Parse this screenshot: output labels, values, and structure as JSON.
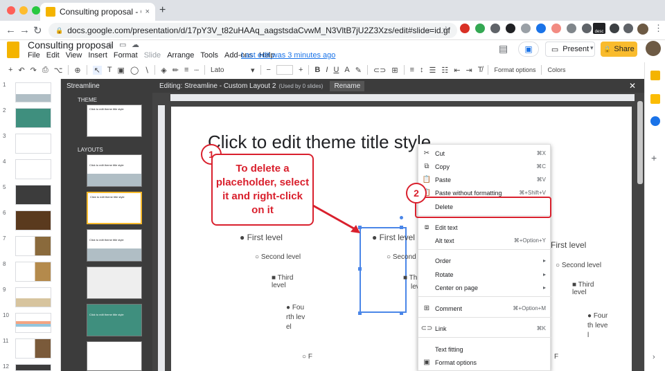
{
  "browser": {
    "tab_title": "Consulting proposal - Google S",
    "tab_close": "×",
    "new_tab": "+",
    "url": "docs.google.com/presentation/d/17pY3V_t82uHAAq_aagstsdaCvwM_N3VltB7jU2Z3Xzs/edit#slide=id.gf0f1c8062...",
    "lock_icon": "🔒",
    "back": "←",
    "forward": "→",
    "reload": "↻",
    "search_icon": "⌕",
    "star_icon": "☆",
    "ext_label_desc": "desc"
  },
  "header": {
    "doc_title": "Consulting proposal",
    "menus": [
      "File",
      "Edit",
      "View",
      "Insert",
      "Format",
      "Slide",
      "Arrange",
      "Tools",
      "Add-ons",
      "Help"
    ],
    "last_edit": "Last edit was 3 minutes ago",
    "present": "Present",
    "share": "Share",
    "comment_icon": "▤",
    "meet_icon": "▣"
  },
  "toolbar": {
    "font": "Lato",
    "format_options": "Format options",
    "colors": "Colors",
    "undo": "↶",
    "redo": "↷",
    "print": "⎙",
    "paint": "⌥",
    "zoom": "⊕",
    "cursor": "↖",
    "textbox": "T",
    "image": "▣",
    "shape": "◯",
    "line": "∖",
    "bold": "B",
    "italic": "I",
    "underline": "U",
    "textcolor": "A",
    "highlight": "✎",
    "link": "⊂⊃",
    "comment": "⊞",
    "align": "≡",
    "spacing": "↕",
    "list1": "☰",
    "list2": "☷",
    "indent": "⇤",
    "indent2": "⇥",
    "clear": "T̸",
    "minus": "−",
    "plus": "+"
  },
  "filmstrip": {
    "numbers": [
      "1",
      "2",
      "3",
      "4",
      "5",
      "6",
      "7",
      "8",
      "9",
      "10",
      "11",
      "12"
    ]
  },
  "master": {
    "title": "Streamline",
    "theme_label": "THEME",
    "layouts_label": "LAYOUTS",
    "theme_thumb_text": "Click to edit theme title style",
    "layout_thumb_text": "Click to edit theme title style"
  },
  "editor": {
    "title": "Editing: Streamline - Custom Layout 2",
    "subtitle": "(Used by 0 slides)",
    "rename": "Rename",
    "close": "✕"
  },
  "slide": {
    "title": "Click to edit theme title style",
    "col1": {
      "first": "First level",
      "second": "Second level",
      "third": "Third level",
      "fourth": "Fourth level",
      "fifth": "F"
    },
    "col2": {
      "first": "First level",
      "second": "Second",
      "third": "Th",
      "third2": "lev"
    },
    "col3": {
      "first": "First level",
      "second": "Second level",
      "third": "Third level",
      "fourth": "Fourth level",
      "fifth": "F"
    }
  },
  "annotation": {
    "callout": "To delete a placeholder, select it and right-click on it",
    "badge1": "1",
    "badge2": "2"
  },
  "context_menu": {
    "items": [
      {
        "icon": "✂",
        "label": "Cut",
        "shortcut": "⌘X"
      },
      {
        "icon": "⧉",
        "label": "Copy",
        "shortcut": "⌘C"
      },
      {
        "icon": "📋",
        "label": "Paste",
        "shortcut": "⌘V"
      },
      {
        "icon": "📋",
        "label": "Paste without formatting",
        "shortcut": "⌘+Shift+V"
      },
      {
        "icon": "",
        "label": "Delete",
        "shortcut": ""
      },
      {
        "icon": "⧈",
        "label": "Edit text",
        "shortcut": ""
      },
      {
        "icon": "",
        "label": "Alt text",
        "shortcut": "⌘+Option+Y"
      },
      {
        "icon": "",
        "label": "Order",
        "shortcut": "▸"
      },
      {
        "icon": "",
        "label": "Rotate",
        "shortcut": "▸"
      },
      {
        "icon": "",
        "label": "Center on page",
        "shortcut": "▸"
      },
      {
        "icon": "⊞",
        "label": "Comment",
        "shortcut": "⌘+Option+M"
      },
      {
        "icon": "⊂⊃",
        "label": "Link",
        "shortcut": "⌘K"
      },
      {
        "icon": "",
        "label": "Text fitting",
        "shortcut": ""
      },
      {
        "icon": "▣",
        "label": "Format options",
        "shortcut": ""
      }
    ]
  },
  "colors": {
    "accent": "#1a73e8",
    "share": "#f9bb2d",
    "annotation_red": "#d9202d",
    "selection_blue": "#4a86e8",
    "master_bg": "#3c3c3c"
  }
}
